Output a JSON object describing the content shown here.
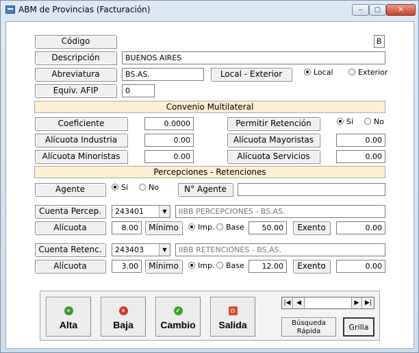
{
  "window": {
    "title": "ABM de Provincias (Facturación)",
    "min": "‒",
    "max": "▢",
    "close": "✕"
  },
  "fields": {
    "codigo_label": "Código",
    "codigo_value": "B",
    "descripcion_label": "Descripción",
    "descripcion_value": "BUENOS AIRES",
    "abreviatura_label": "Abreviatura",
    "abreviatura_value": "BS.AS.",
    "local_exterior_label": "Local - Exterior",
    "local_option": "Local",
    "exterior_option": "Exterior",
    "afip_label": "Equiv. AFIP",
    "afip_value": "0"
  },
  "convenio": {
    "title": "Convenio Multilateral",
    "coeficiente_label": "Coeficiente",
    "coeficiente_value": "0.0000",
    "permitir_label": "Permitir Retención",
    "si": "Sí",
    "no": "No",
    "industria_label": "Alícuota Industria",
    "industria_value": "0.00",
    "mayoristas_label": "Alícuota Mayoristas",
    "mayoristas_value": "0.00",
    "minoristas_label": "Alícuota Minoristas",
    "minoristas_value": "0.00",
    "servicios_label": "Alícuota Servicios",
    "servicios_value": "0.00"
  },
  "percepciones": {
    "title": "Percepciones - Retenciones",
    "agente_label": "Agente",
    "si": "Sí",
    "no": "No",
    "nro_agente_label": "N° Agente",
    "nro_agente_value": "",
    "percep": {
      "cuenta_label": "Cuenta Percep.",
      "cuenta": "243401",
      "desc": "IIBB PERCEPCIONES - BS.AS.",
      "alicuota_label": "Alícuota",
      "alicuota": "8.00",
      "minimo_label": "Mínimo",
      "imp": "Imp.",
      "base": "Base",
      "minimo_value": "50.00",
      "exento_label": "Exento",
      "exento_value": "0.00"
    },
    "reten": {
      "cuenta_label": "Cuenta Retenc.",
      "cuenta": "243403",
      "desc": "IIBB RETENCIONES - BS.AS.",
      "alicuota_label": "Alícuota",
      "alicuota": "3.00",
      "minimo_label": "Mínimo",
      "imp": "Imp.",
      "base": "Base",
      "minimo_value": "12.00",
      "exento_label": "Exento",
      "exento_value": "0.00"
    }
  },
  "buttons": {
    "alta": "Alta",
    "baja": "Baja",
    "cambio": "Cambio",
    "salida": "Salida",
    "busqueda1": "Búsqueda",
    "busqueda2": "Rápida",
    "grilla": "Grilla"
  },
  "icons": {
    "alta": "plus-icon",
    "baja": "x-icon",
    "cambio": "check-icon",
    "salida": "exit-icon",
    "colors": {
      "alta": "#3a9a2a",
      "baja": "#d23a2a",
      "cambio": "#3aa02a",
      "salida": "#d84a2a"
    }
  },
  "nav": {
    "first": "|◀",
    "prev": "◀",
    "next": "▶",
    "last": "▶|"
  }
}
